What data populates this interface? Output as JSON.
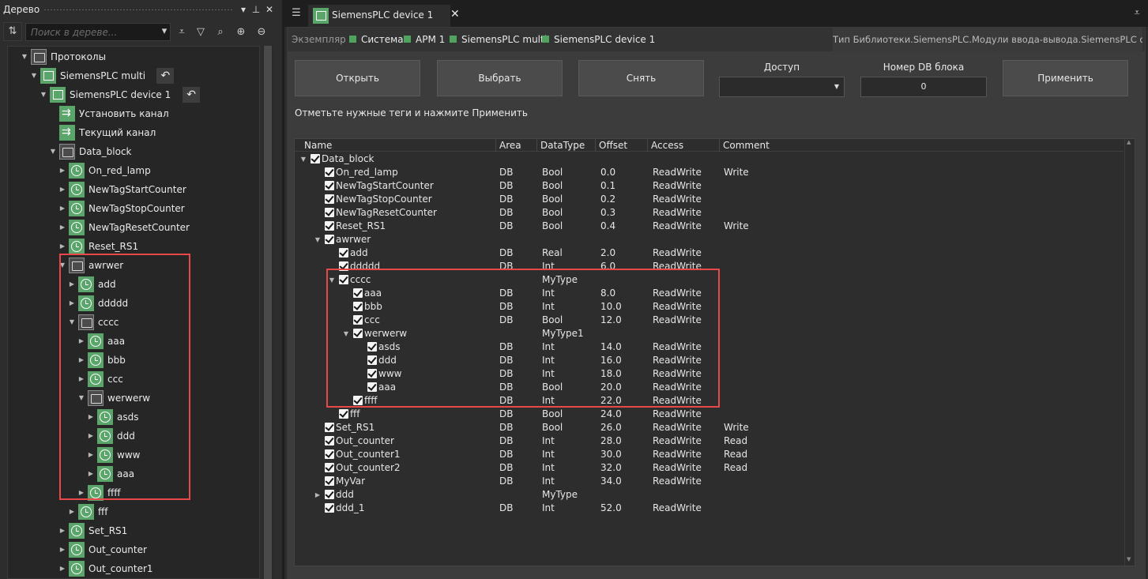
{
  "left_panel": {
    "title": "Дерево",
    "search_placeholder": "Поиск в дереве...",
    "tree": [
      {
        "label": "Протоколы",
        "icon": "folder-icon",
        "depth": 0,
        "expanded": true
      },
      {
        "label": "SiemensPLC multi",
        "icon": "device-icon",
        "depth": 1,
        "expanded": true,
        "undo": true
      },
      {
        "label": "SiemensPLC device 1",
        "icon": "device-icon",
        "depth": 2,
        "expanded": true,
        "undo": true
      },
      {
        "label": "Установить канал",
        "icon": "channel-icon",
        "depth": 3,
        "leaf": true
      },
      {
        "label": "Текущий канал",
        "icon": "channel-icon",
        "depth": 3,
        "leaf": true
      },
      {
        "label": "Data_block",
        "icon": "folder-icon",
        "depth": 3,
        "expanded": true
      },
      {
        "label": "On_red_lamp",
        "icon": "tag-icon",
        "depth": 4
      },
      {
        "label": "NewTagStartCounter",
        "icon": "tag-icon",
        "depth": 4
      },
      {
        "label": "NewTagStopCounter",
        "icon": "tag-icon",
        "depth": 4
      },
      {
        "label": "NewTagResetCounter",
        "icon": "tag-icon",
        "depth": 4
      },
      {
        "label": "Reset_RS1",
        "icon": "tag-icon",
        "depth": 4
      },
      {
        "label": "awrwer",
        "icon": "folder-icon",
        "depth": 4,
        "expanded": true
      },
      {
        "label": "add",
        "icon": "tag-icon",
        "depth": 5
      },
      {
        "label": "ddddd",
        "icon": "tag-icon",
        "depth": 5
      },
      {
        "label": "cccc",
        "icon": "folder-icon",
        "depth": 5,
        "expanded": true
      },
      {
        "label": "aaa",
        "icon": "tag-icon",
        "depth": 6
      },
      {
        "label": "bbb",
        "icon": "tag-icon",
        "depth": 6
      },
      {
        "label": "ccc",
        "icon": "tag-icon",
        "depth": 6
      },
      {
        "label": "werwerw",
        "icon": "folder-icon",
        "depth": 6,
        "expanded": true
      },
      {
        "label": "asds",
        "icon": "tag-icon",
        "depth": 7
      },
      {
        "label": "ddd",
        "icon": "tag-icon",
        "depth": 7
      },
      {
        "label": "www",
        "icon": "tag-icon",
        "depth": 7
      },
      {
        "label": "aaa",
        "icon": "tag-icon",
        "depth": 7
      },
      {
        "label": "ffff",
        "icon": "tag-icon",
        "depth": 6
      },
      {
        "label": "fff",
        "icon": "tag-icon",
        "depth": 5
      },
      {
        "label": "Set_RS1",
        "icon": "tag-icon",
        "depth": 4
      },
      {
        "label": "Out_counter",
        "icon": "tag-icon",
        "depth": 4
      },
      {
        "label": "Out_counter1",
        "icon": "tag-icon",
        "depth": 4
      }
    ]
  },
  "document": {
    "tab_label": "SiemensPLC device 1",
    "close_glyph": "✕",
    "breadcrumb_label": "Экземпляр",
    "breadcrumb": [
      "Система",
      "АРМ 1",
      "SiemensPLC multi",
      "SiemensPLC device 1"
    ],
    "library_type": "Тип Библиотеки.SiemensPLC.Модули ввода-вывода.SiemensPLC device"
  },
  "toolbar": {
    "open_label": "Открыть",
    "select_label": "Выбрать",
    "deselect_label": "Снять",
    "access_label": "Доступ",
    "access_value": "",
    "db_label": "Номер DB блока",
    "db_value": "0",
    "apply_label": "Применить"
  },
  "hint": "Отметьте нужные теги и нажмите Применить",
  "grid": {
    "columns": [
      "Name",
      "Area",
      "DataType",
      "Offset",
      "Access",
      "Comment"
    ],
    "rows": [
      {
        "name": "Data_block",
        "depth": 0,
        "expander": "open",
        "area": "",
        "type": "",
        "offset": "",
        "access": "",
        "comment": ""
      },
      {
        "name": "On_red_lamp",
        "depth": 1,
        "area": "DB",
        "type": "Bool",
        "offset": "0.0",
        "access": "ReadWrite",
        "comment": "Write"
      },
      {
        "name": "NewTagStartCounter",
        "depth": 1,
        "area": "DB",
        "type": "Bool",
        "offset": "0.1",
        "access": "ReadWrite",
        "comment": ""
      },
      {
        "name": "NewTagStopCounter",
        "depth": 1,
        "area": "DB",
        "type": "Bool",
        "offset": "0.2",
        "access": "ReadWrite",
        "comment": ""
      },
      {
        "name": "NewTagResetCounter",
        "depth": 1,
        "area": "DB",
        "type": "Bool",
        "offset": "0.3",
        "access": "ReadWrite",
        "comment": ""
      },
      {
        "name": "Reset_RS1",
        "depth": 1,
        "area": "DB",
        "type": "Bool",
        "offset": "0.4",
        "access": "ReadWrite",
        "comment": "Write"
      },
      {
        "name": "awrwer",
        "depth": 1,
        "expander": "open",
        "area": "",
        "type": "",
        "offset": "",
        "access": "",
        "comment": ""
      },
      {
        "name": "add",
        "depth": 2,
        "area": "DB",
        "type": "Real",
        "offset": "2.0",
        "access": "ReadWrite",
        "comment": ""
      },
      {
        "name": "ddddd",
        "depth": 2,
        "area": "DB",
        "type": "Int",
        "offset": "6.0",
        "access": "ReadWrite",
        "comment": ""
      },
      {
        "name": "cccc",
        "depth": 2,
        "expander": "open",
        "area": "",
        "type": "MyType",
        "offset": "",
        "access": "",
        "comment": ""
      },
      {
        "name": "aaa",
        "depth": 3,
        "area": "DB",
        "type": "Int",
        "offset": "8.0",
        "access": "ReadWrite",
        "comment": ""
      },
      {
        "name": "bbb",
        "depth": 3,
        "area": "DB",
        "type": "Int",
        "offset": "10.0",
        "access": "ReadWrite",
        "comment": ""
      },
      {
        "name": "ccc",
        "depth": 3,
        "area": "DB",
        "type": "Bool",
        "offset": "12.0",
        "access": "ReadWrite",
        "comment": ""
      },
      {
        "name": "werwerw",
        "depth": 3,
        "expander": "open",
        "area": "",
        "type": "MyType1",
        "offset": "",
        "access": "",
        "comment": ""
      },
      {
        "name": "asds",
        "depth": 4,
        "area": "DB",
        "type": "Int",
        "offset": "14.0",
        "access": "ReadWrite",
        "comment": ""
      },
      {
        "name": "ddd",
        "depth": 4,
        "area": "DB",
        "type": "Int",
        "offset": "16.0",
        "access": "ReadWrite",
        "comment": ""
      },
      {
        "name": "www",
        "depth": 4,
        "area": "DB",
        "type": "Int",
        "offset": "18.0",
        "access": "ReadWrite",
        "comment": ""
      },
      {
        "name": "aaa",
        "depth": 4,
        "area": "DB",
        "type": "Bool",
        "offset": "20.0",
        "access": "ReadWrite",
        "comment": ""
      },
      {
        "name": "ffff",
        "depth": 3,
        "area": "DB",
        "type": "Int",
        "offset": "22.0",
        "access": "ReadWrite",
        "comment": ""
      },
      {
        "name": "fff",
        "depth": 2,
        "area": "DB",
        "type": "Bool",
        "offset": "24.0",
        "access": "ReadWrite",
        "comment": ""
      },
      {
        "name": "Set_RS1",
        "depth": 1,
        "area": "DB",
        "type": "Bool",
        "offset": "26.0",
        "access": "ReadWrite",
        "comment": "Write"
      },
      {
        "name": "Out_counter",
        "depth": 1,
        "area": "DB",
        "type": "Int",
        "offset": "28.0",
        "access": "ReadWrite",
        "comment": "Read"
      },
      {
        "name": "Out_counter1",
        "depth": 1,
        "area": "DB",
        "type": "Int",
        "offset": "30.0",
        "access": "ReadWrite",
        "comment": "Read"
      },
      {
        "name": "Out_counter2",
        "depth": 1,
        "area": "DB",
        "type": "Int",
        "offset": "32.0",
        "access": "ReadWrite",
        "comment": "Read"
      },
      {
        "name": "MyVar",
        "depth": 1,
        "area": "DB",
        "type": "Int",
        "offset": "34.0",
        "access": "ReadWrite",
        "comment": ""
      },
      {
        "name": "ddd",
        "depth": 1,
        "expander": "closed",
        "area": "",
        "type": "MyType",
        "offset": "",
        "access": "",
        "comment": ""
      },
      {
        "name": "ddd_1",
        "depth": 1,
        "area": "DB",
        "type": "Int",
        "offset": "52.0",
        "access": "ReadWrite",
        "comment": ""
      }
    ]
  },
  "colors": {
    "accent_green": "#5aa56a",
    "highlight_red": "#e84848"
  }
}
